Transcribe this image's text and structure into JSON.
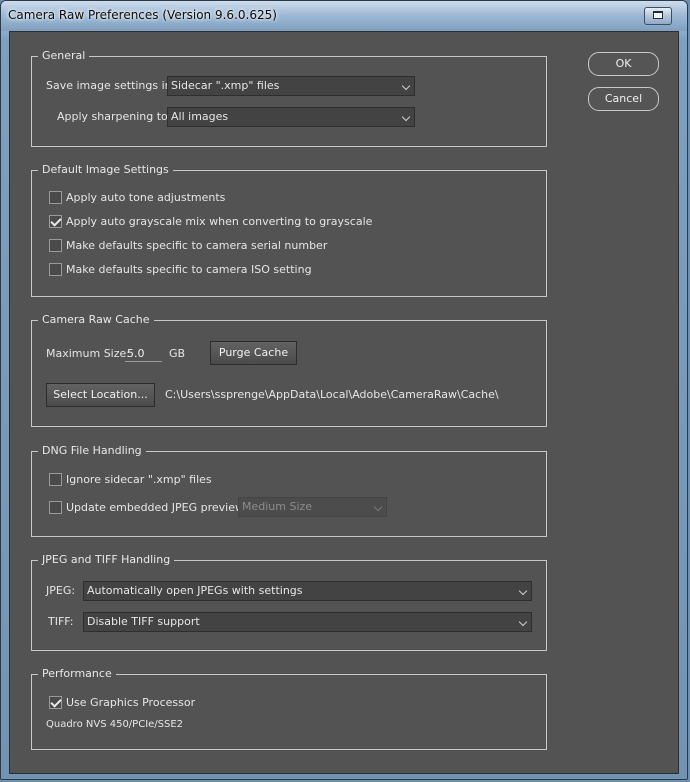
{
  "window": {
    "title": "Camera Raw Preferences  (Version 9.6.0.625)"
  },
  "buttons": {
    "ok": "OK",
    "cancel": "Cancel"
  },
  "general": {
    "legend": "General",
    "save_label": "Save image settings in:",
    "save_value": "Sidecar \".xmp\" files",
    "sharpen_label": "Apply sharpening to:",
    "sharpen_value": "All images"
  },
  "defaults": {
    "legend": "Default Image Settings",
    "options": [
      {
        "label": "Apply auto tone adjustments",
        "checked": false
      },
      {
        "label": "Apply auto grayscale mix when converting to grayscale",
        "checked": true
      },
      {
        "label": "Make defaults specific to camera serial number",
        "checked": false
      },
      {
        "label": "Make defaults specific to camera ISO setting",
        "checked": false
      }
    ]
  },
  "cache": {
    "legend": "Camera Raw Cache",
    "max_label": "Maximum Size:",
    "max_value": "5.0",
    "unit": "GB",
    "purge": "Purge Cache",
    "select_location": "Select Location...",
    "path": "C:\\Users\\ssprenge\\AppData\\Local\\Adobe\\CameraRaw\\Cache\\"
  },
  "dng": {
    "legend": "DNG File Handling",
    "ignore_label": "Ignore sidecar \".xmp\" files",
    "ignore_checked": false,
    "update_label": "Update embedded JPEG previews:",
    "update_checked": false,
    "preview_value": "Medium Size"
  },
  "jpeg_tiff": {
    "legend": "JPEG and TIFF Handling",
    "jpeg_label": "JPEG:",
    "jpeg_value": "Automatically open JPEGs with settings",
    "tiff_label": "TIFF:",
    "tiff_value": "Disable TIFF support"
  },
  "performance": {
    "legend": "Performance",
    "gpu_label": "Use Graphics Processor",
    "gpu_checked": true,
    "gpu_info": "Quadro NVS 450/PCIe/SSE2"
  }
}
